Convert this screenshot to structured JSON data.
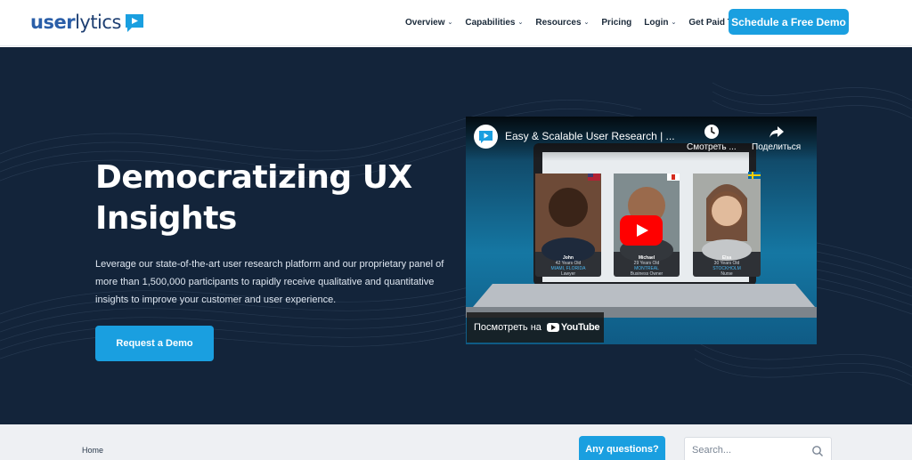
{
  "brand": {
    "logo_part1": "user",
    "logo_part2": "lytics",
    "accent": "#1a9fe0",
    "dark": "#13243a"
  },
  "nav": {
    "items": [
      {
        "label": "Overview",
        "dropdown": true
      },
      {
        "label": "Capabilities",
        "dropdown": true
      },
      {
        "label": "Resources",
        "dropdown": true
      },
      {
        "label": "Pricing",
        "dropdown": false
      },
      {
        "label": "Login",
        "dropdown": true
      },
      {
        "label": "Get Paid To Test",
        "dropdown": false
      }
    ],
    "cta_label": "Schedule a Free Demo"
  },
  "hero": {
    "title_line1": "Democratizing UX",
    "title_line2": "Insights",
    "description": "Leverage our state-of-the-art user research platform and our proprietary panel of more than 1,500,000 participants to rapidly receive qualitative and quantitative insights to improve your customer and user experience.",
    "button_label": "Request a Demo"
  },
  "video": {
    "title": "Easy & Scalable User Research | ...",
    "watch_later_label": "Смотреть ...",
    "share_label": "Поделиться",
    "watch_on_label": "Посмотреть на",
    "youtube_label": "YouTube",
    "participants": [
      {
        "name": "John",
        "age": "42 Years Old",
        "location": "MIAMI, FLORIDA",
        "role": "Lawyer"
      },
      {
        "name": "Michael",
        "age": "29 Years Old",
        "location": "MONTREAL",
        "role": "Business Owner"
      },
      {
        "name": "Elsa",
        "age": "30 Years Old",
        "location": "STOCKHOLM",
        "role": "Nurse"
      }
    ]
  },
  "bottom": {
    "breadcrumb": "Home",
    "questions_label": "Any questions?",
    "search_placeholder": "Search..."
  }
}
